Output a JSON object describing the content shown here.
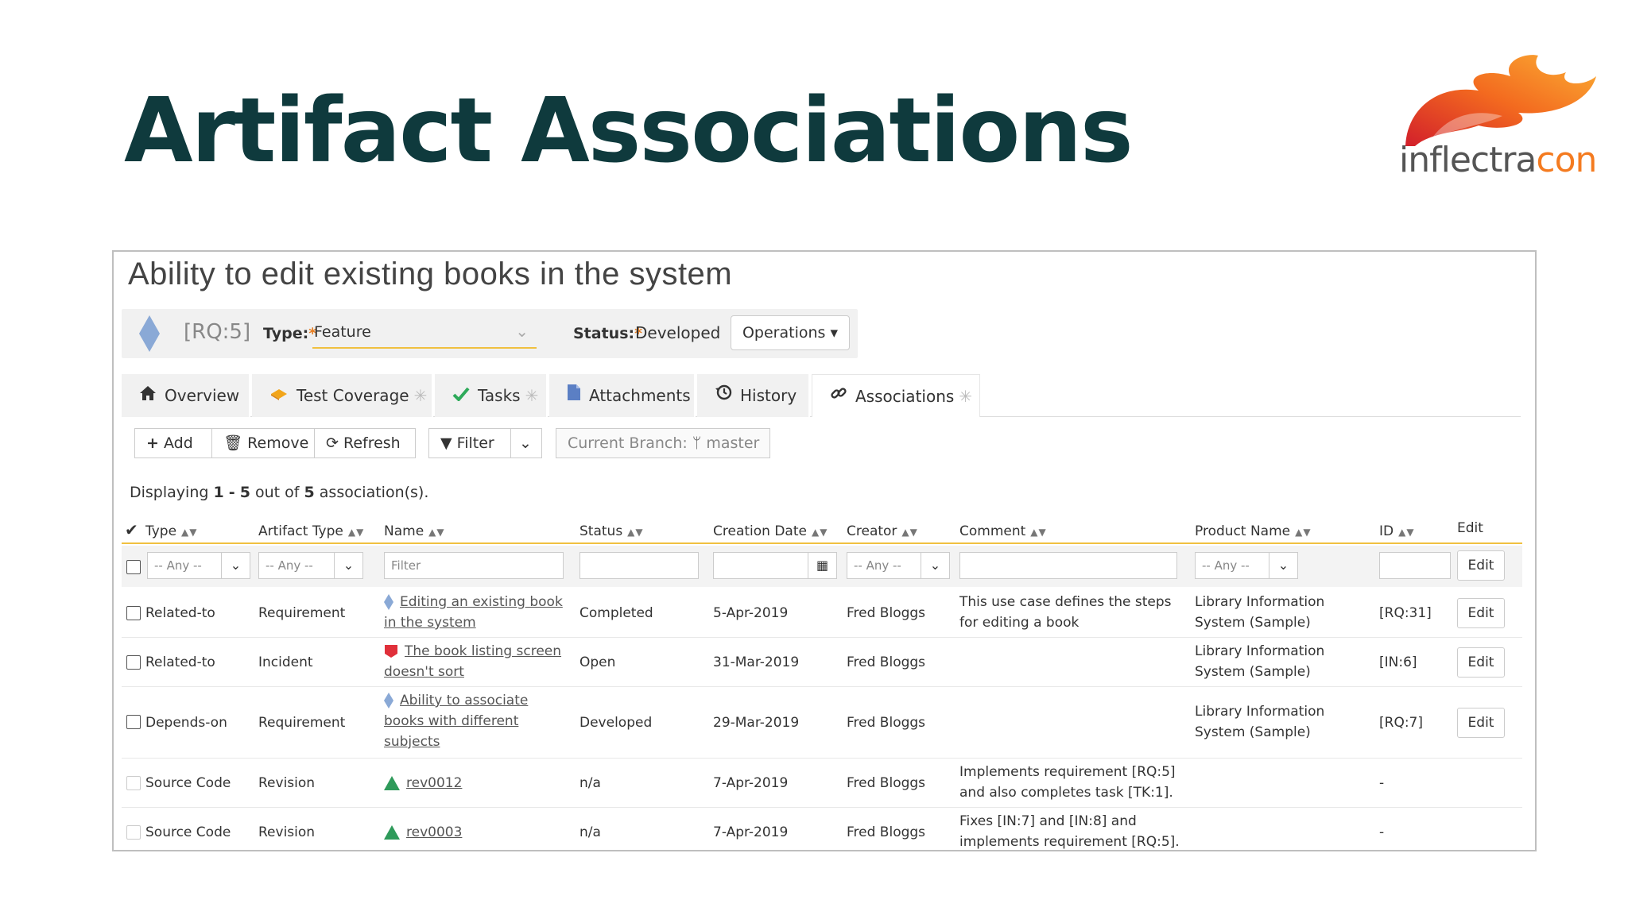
{
  "slide": {
    "title": "Artifact Associations"
  },
  "logo": {
    "text_main": "inflectra",
    "text_accent": "con"
  },
  "artifact": {
    "heading": "Ability to edit existing books in the system",
    "id": "[RQ:5]",
    "type_label": "Type:",
    "type_value": "Feature",
    "status_label": "Status:",
    "status_value": "Developed",
    "operations_label": "Operations"
  },
  "tabs": [
    {
      "label": "Overview",
      "icon": "home-icon"
    },
    {
      "label": "Test Coverage",
      "icon": "test-coverage-icon"
    },
    {
      "label": "Tasks",
      "icon": "check-icon"
    },
    {
      "label": "Attachments",
      "icon": "file-icon"
    },
    {
      "label": "History",
      "icon": "history-icon"
    },
    {
      "label": "Associations",
      "icon": "link-icon"
    }
  ],
  "toolbar": {
    "add": "Add",
    "remove": "Remove",
    "refresh": "Refresh",
    "filter": "Filter",
    "branch_label": "Current Branch:",
    "branch_value": "master"
  },
  "display": {
    "prefix": "Displaying",
    "from": "1",
    "dash": "-",
    "to": "5",
    "out_of": "out of",
    "total": "5",
    "suffix": "association(s)."
  },
  "columns": {
    "type": "Type",
    "artifact_type": "Artifact Type",
    "name": "Name",
    "status": "Status",
    "creation_date": "Creation Date",
    "creator": "Creator",
    "comment": "Comment",
    "product_name": "Product Name",
    "id": "ID",
    "edit": "Edit"
  },
  "filters": {
    "any": "-- Any --",
    "name_placeholder": "Filter",
    "edit": "Edit"
  },
  "rows": [
    {
      "type": "Related-to",
      "artifact_type": "Requirement",
      "name1": "Editing an existing book",
      "name2": "in the system",
      "name3": "",
      "status": "Completed",
      "date": "5-Apr-2019",
      "creator": "Fred Bloggs",
      "comment1": "This use case defines the steps",
      "comment2": "for editing a book",
      "product1": "Library Information",
      "product2": "System (Sample)",
      "id": "[RQ:31]",
      "edit": "Edit"
    },
    {
      "type": "Related-to",
      "artifact_type": "Incident",
      "name1": "The book listing screen",
      "name2": "doesn't sort",
      "name3": "",
      "status": "Open",
      "date": "31-Mar-2019",
      "creator": "Fred Bloggs",
      "comment1": "",
      "comment2": "",
      "product1": "Library Information",
      "product2": "System (Sample)",
      "id": "[IN:6]",
      "edit": "Edit"
    },
    {
      "type": "Depends-on",
      "artifact_type": "Requirement",
      "name1": "Ability to associate",
      "name2": "books with different",
      "name3": "subjects",
      "status": "Developed",
      "date": "29-Mar-2019",
      "creator": "Fred Bloggs",
      "comment1": "",
      "comment2": "",
      "product1": "Library Information",
      "product2": "System (Sample)",
      "id": "[RQ:7]",
      "edit": "Edit"
    },
    {
      "type": "Source Code",
      "artifact_type": "Revision",
      "name1": "rev0012",
      "name2": "",
      "name3": "",
      "status": "n/a",
      "date": "7-Apr-2019",
      "creator": "Fred Bloggs",
      "comment1": "Implements requirement [RQ:5]",
      "comment2": "and also completes task [TK:1].",
      "product1": "",
      "product2": "",
      "id": "-",
      "edit": ""
    },
    {
      "type": "Source Code",
      "artifact_type": "Revision",
      "name1": "rev0003",
      "name2": "",
      "name3": "",
      "status": "n/a",
      "date": "7-Apr-2019",
      "creator": "Fred Bloggs",
      "comment1": "Fixes [IN:7] and [IN:8] and",
      "comment2": "implements requirement [RQ:5].",
      "product1": "",
      "product2": "",
      "id": "-",
      "edit": ""
    }
  ],
  "colors": {
    "title": "#0f3a3d",
    "accent_orange": "#f47b20",
    "filter_underline": "#f0c040",
    "requirement": "#8aa9d6",
    "incident": "#e0303a",
    "revision": "#2e9a5a"
  }
}
